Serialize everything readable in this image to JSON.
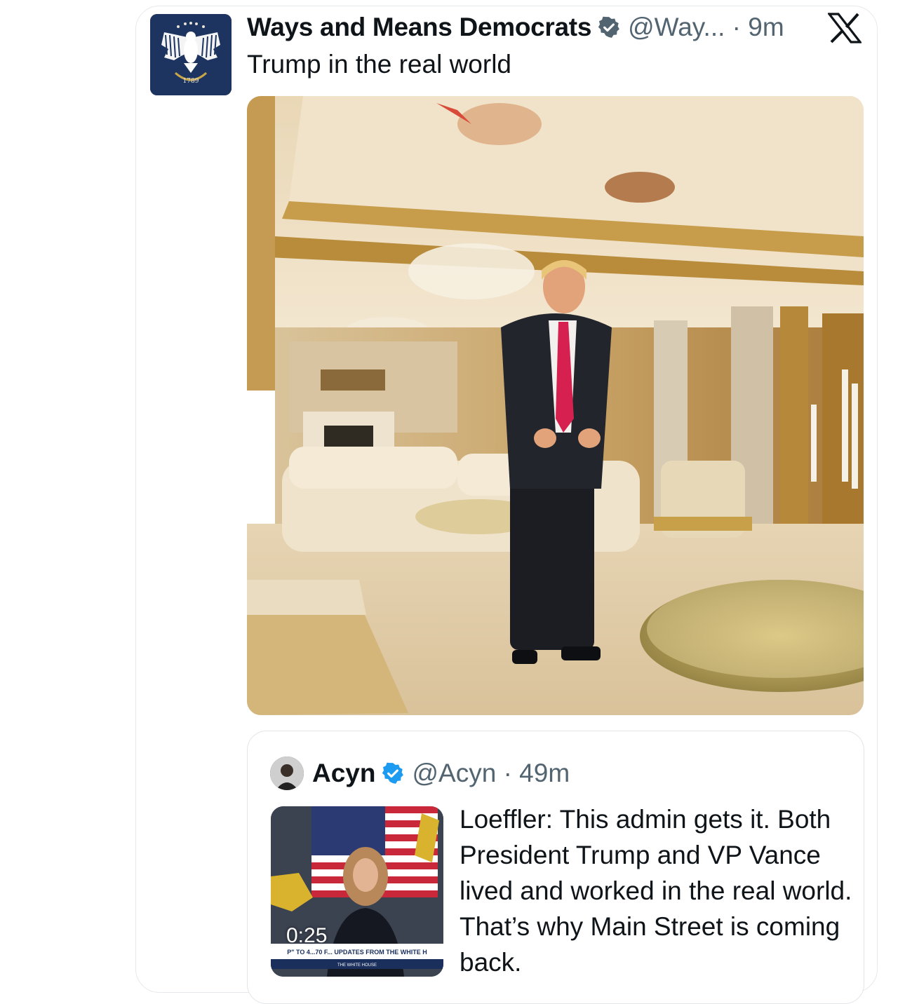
{
  "tweet": {
    "author_name": "Ways and Means Democrats",
    "handle_time": "@Way... · 9m",
    "text": "Trump in the real world",
    "avatar_year": "1789",
    "verified_color": "#536471",
    "avatar_bg": "#1d3461"
  },
  "quote": {
    "author_name": "Acyn",
    "handle_time": "@Acyn · 49m",
    "text": "Loeffler: This admin gets it. Both President Trump and VP Vance lived and worked in the real world. That’s why Main Street is coming back.",
    "video_duration": "0:25",
    "video_banner": "P\" TO 4...70 F... UPDATES FROM THE WHITE H",
    "video_subbanner": "THE WHITE HOUSE",
    "verified_color": "#1d9bf0"
  },
  "icons": {
    "brand": "x-logo-icon",
    "verified": "verified-badge-icon"
  }
}
